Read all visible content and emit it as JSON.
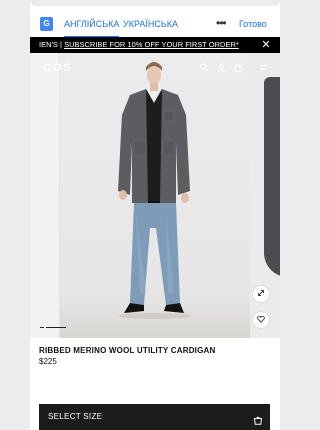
{
  "translate_bar": {
    "icon": "google-translate-icon",
    "lang_source": "АНГЛІЙСЬКА",
    "lang_target": "УКРАЇНСЬКА",
    "more": "•••",
    "done": "Готово"
  },
  "promo": {
    "lead": "IEN'S | ",
    "text": "SUBSCRIBE FOR 10% OFF YOUR FIRST ORDER*",
    "close": "✕"
  },
  "header": {
    "logo": "COS",
    "icons": [
      "search-icon",
      "account-icon",
      "bag-icon",
      "menu-icon"
    ]
  },
  "gallery": {
    "zoom_icon": "expand-icon",
    "wishlist_icon": "heart-icon",
    "slides": 5,
    "active_slide": 1
  },
  "product": {
    "title": "RIBBED MERINO WOOL UTILITY CARDIGAN",
    "price": "$225"
  },
  "cta": {
    "label": "SELECT SIZE",
    "icon": "shopping-bag-icon"
  },
  "colors": {
    "accent": "#1a73e8",
    "promo_bg": "#000000",
    "cta_bg": "#1c1c1c"
  }
}
